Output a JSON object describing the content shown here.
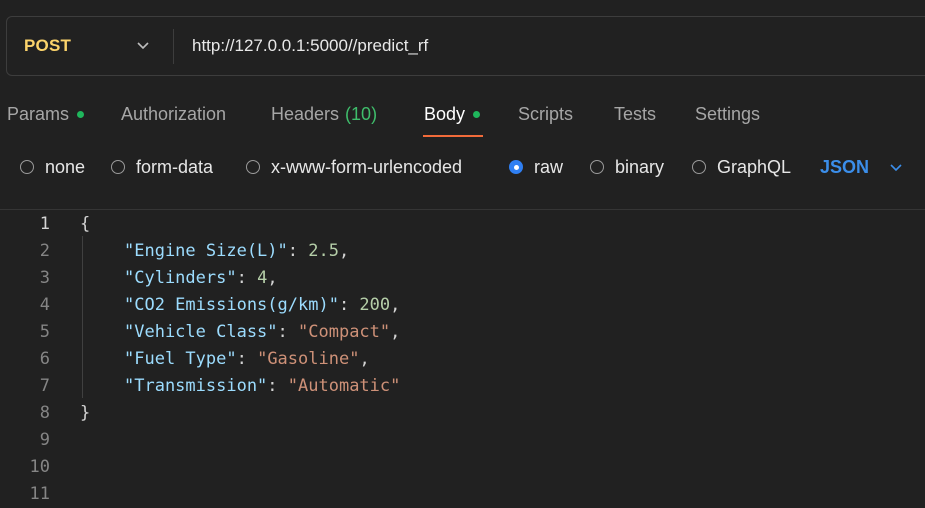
{
  "request": {
    "method": "POST",
    "url": "http://127.0.0.1:5000//predict_rf"
  },
  "tabs": [
    {
      "label": "Params",
      "dot": true
    },
    {
      "label": "Authorization"
    },
    {
      "label": "Headers",
      "count": "(10)"
    },
    {
      "label": "Body",
      "dot": true,
      "active": true
    },
    {
      "label": "Scripts"
    },
    {
      "label": "Tests"
    },
    {
      "label": "Settings"
    }
  ],
  "body_types": [
    {
      "label": "none",
      "selected": false
    },
    {
      "label": "form-data",
      "selected": false
    },
    {
      "label": "x-www-form-urlencoded",
      "selected": false
    },
    {
      "label": "raw",
      "selected": true
    },
    {
      "label": "binary",
      "selected": false
    },
    {
      "label": "GraphQL",
      "selected": false
    }
  ],
  "format": "JSON",
  "editor": {
    "line_numbers": [
      "1",
      "2",
      "3",
      "4",
      "5",
      "6",
      "7",
      "8",
      "9",
      "10",
      "11"
    ],
    "open_brace": "{",
    "close_brace": "}",
    "entries": [
      {
        "key": "\"Engine Size(L)\"",
        "value": "2.5",
        "type": "number"
      },
      {
        "key": "\"Cylinders\"",
        "value": "4",
        "type": "number"
      },
      {
        "key": "\"CO2 Emissions(g/km)\"",
        "value": "200",
        "type": "number"
      },
      {
        "key": "\"Vehicle Class\"",
        "value": "\"Compact\"",
        "type": "string"
      },
      {
        "key": "\"Fuel Type\"",
        "value": "\"Gasoline\"",
        "type": "string"
      },
      {
        "key": "\"Transmission\"",
        "value": "\"Automatic\"",
        "type": "string"
      }
    ]
  },
  "colors": {
    "method": "#fbd36b",
    "tab_dot": "#1fb65c",
    "tab_underline": "#f26b3a",
    "radio_selected": "#2f7ff2",
    "format": "#3b8eea",
    "json_key": "#9cdcfe",
    "json_number": "#b5cea8",
    "json_string": "#ce9178"
  }
}
